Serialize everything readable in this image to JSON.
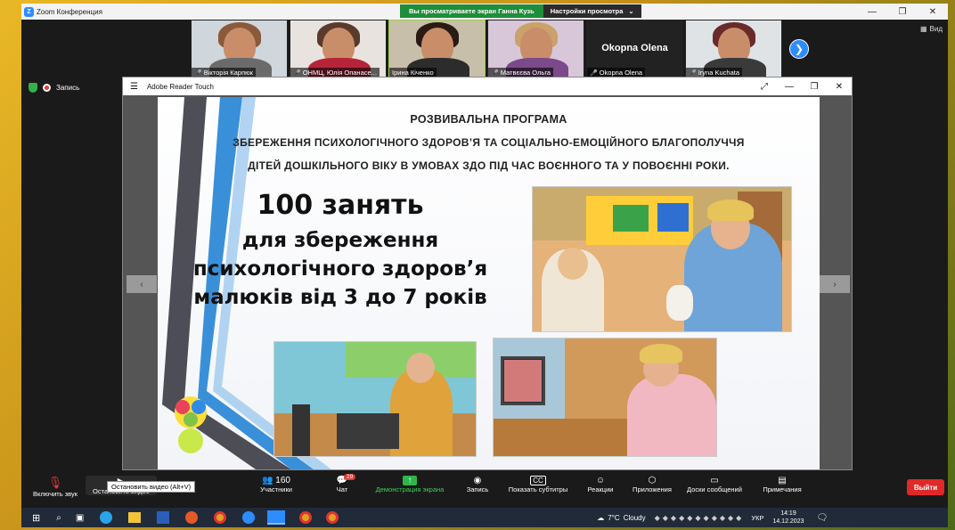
{
  "app": {
    "title": "Zoom Конференция",
    "share_notice": "Вы просматриваете экран Ганна Кузь",
    "view_settings": "Настройки просмотра",
    "view_label": "Вид"
  },
  "participants_strip": [
    {
      "name": "Вікторія Карпюк",
      "muted": true
    },
    {
      "name": "ОНМЦ, Юлія Опанасе...",
      "muted": true
    },
    {
      "name": "Ірина Кіченко",
      "muted": false
    },
    {
      "name": "Матвєєва Ольга",
      "muted": true
    },
    {
      "name": "Okopna Olena",
      "muted": true,
      "big_name": "Okopna Olena"
    },
    {
      "name": "Iryna Kuchata",
      "muted": true
    }
  ],
  "status": {
    "recording_label": "Запись"
  },
  "reader": {
    "title": "Adobe Reader Touch"
  },
  "slide": {
    "heading_1": "РОЗВИВАЛЬНА ПРОГРАМА",
    "heading_2": "ЗБЕРЕЖЕННЯ ПСИХОЛОГІЧНОГО ЗДОРОВ’Я ТА СОЦІАЛЬНО-ЕМОЦІЙНОГО БЛАГОПОЛУЧЧЯ",
    "heading_3": "ДІТЕЙ ДОШКІЛЬНОГО ВІКУ В УМОВАХ ЗДО ПІД ЧАС ВОЄННОГО ТА У ПОВОЄННІ РОКИ.",
    "big_number_line": "100 занять",
    "line_2": "для збереження",
    "line_3": "психологічного здоров’я",
    "line_4": "малюків від 3 до 7 років",
    "prev": "‹",
    "next": "›"
  },
  "toolbar": {
    "unmute": "Включить звук",
    "stop_video": "Остановить видео",
    "stop_video_tooltip": "Остановить видео (Alt+V)",
    "participants": "Участники",
    "participants_count": "160",
    "chat": "Чат",
    "chat_badge": "29",
    "share_screen": "Демонстрация экрана",
    "record": "Запись",
    "captions": "Показать субтитры",
    "reactions": "Реакции",
    "apps": "Приложения",
    "whiteboards": "Доски сообщений",
    "notes": "Примечания",
    "leave": "Выйти"
  },
  "taskbar": {
    "weather_temp": "7°C",
    "weather_desc": "Cloudy",
    "language": "УКР",
    "time": "14:19",
    "date": "14.12.2023"
  },
  "colors": {
    "zoom_blue": "#2d8cff",
    "share_green": "#1f8d3a",
    "leave_red": "#e02828",
    "slide_blue": "#3a8fd9"
  }
}
